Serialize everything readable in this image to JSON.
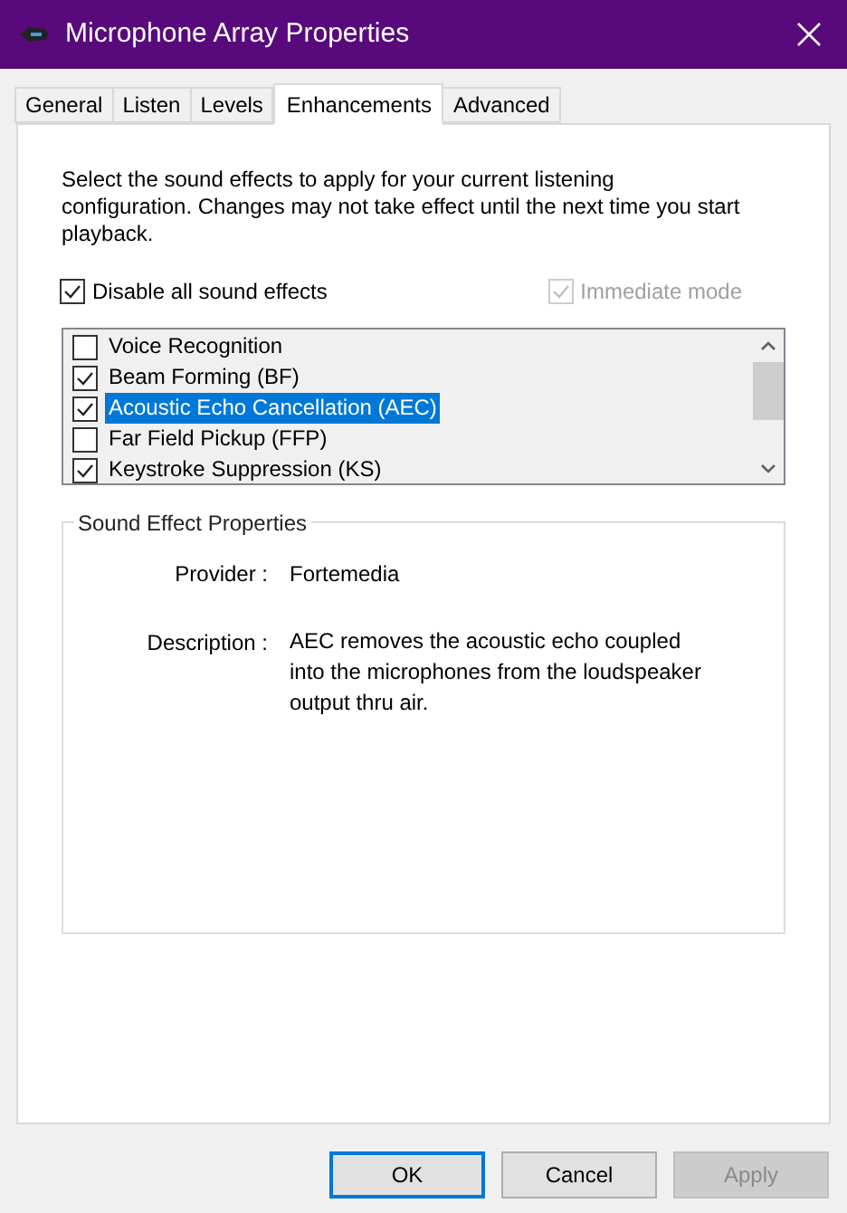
{
  "window": {
    "title": "Microphone Array Properties"
  },
  "tabs": [
    {
      "label": "General",
      "selected": false
    },
    {
      "label": "Listen",
      "selected": false
    },
    {
      "label": "Levels",
      "selected": false
    },
    {
      "label": "Enhancements",
      "selected": true
    },
    {
      "label": "Advanced",
      "selected": false
    }
  ],
  "intro": "Select the sound effects to apply for your current listening configuration. Changes may not take effect until the next time you start playback.",
  "disable_all": {
    "label": "Disable all sound effects",
    "checked": true
  },
  "immediate_mode": {
    "label": "Immediate mode",
    "checked": true,
    "disabled": true
  },
  "effects": [
    {
      "label": "Voice Recognition",
      "checked": false,
      "selected": false
    },
    {
      "label": "Beam Forming (BF)",
      "checked": true,
      "selected": false
    },
    {
      "label": "Acoustic Echo Cancellation (AEC)",
      "checked": true,
      "selected": true
    },
    {
      "label": "Far Field Pickup (FFP)",
      "checked": false,
      "selected": false
    },
    {
      "label": "Keystroke Suppression (KS)",
      "checked": true,
      "selected": false
    }
  ],
  "properties": {
    "title": "Sound Effect Properties",
    "provider_label": "Provider :",
    "provider": "Fortemedia",
    "description_label": "Description :",
    "description": "AEC removes the acoustic echo coupled into the microphones from the loudspeaker output thru air."
  },
  "buttons": [
    {
      "label": "OK",
      "kind": "default",
      "disabled": false
    },
    {
      "label": "Cancel",
      "kind": "normal",
      "disabled": false
    },
    {
      "label": "Apply",
      "kind": "normal",
      "disabled": true
    }
  ]
}
